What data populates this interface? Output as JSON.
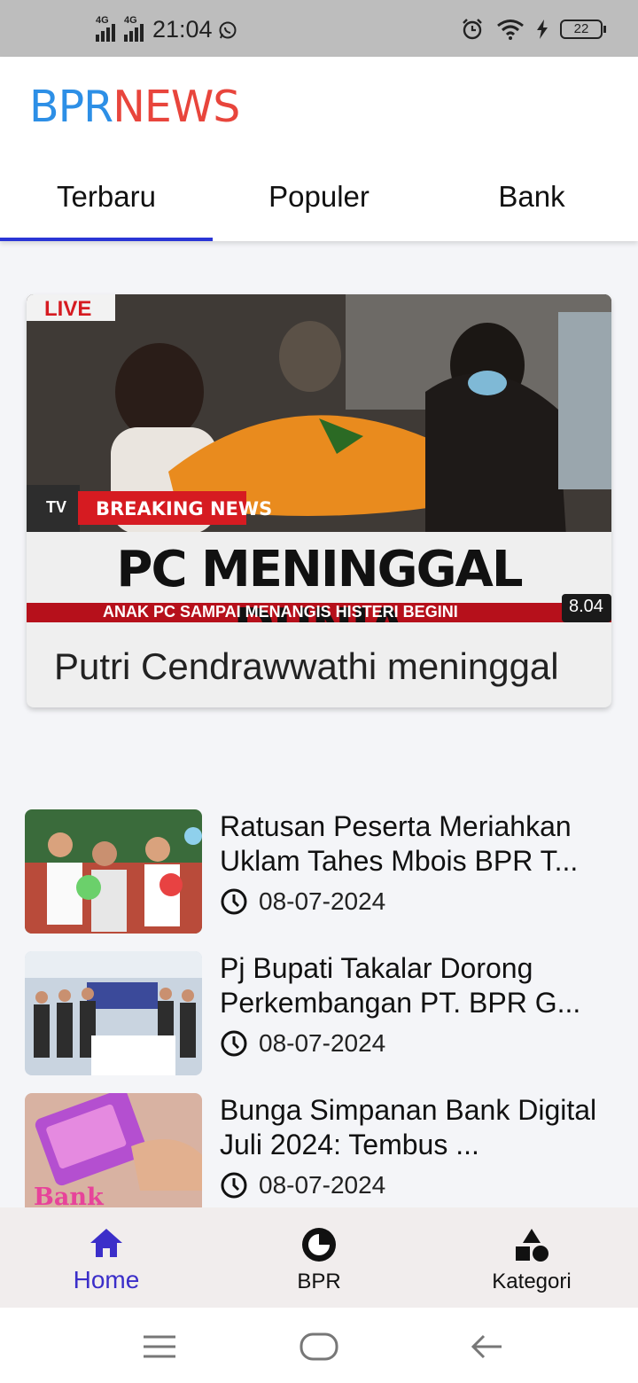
{
  "status": {
    "time": "21:04",
    "net1": "4G",
    "net2": "4G",
    "battery": "22"
  },
  "app": {
    "logo_part1": "BPR",
    "logo_part2": "NEWS"
  },
  "tabs": [
    {
      "label": "Terbaru"
    },
    {
      "label": "Populer"
    },
    {
      "label": "Bank"
    }
  ],
  "hero": {
    "live_label": "LIVE",
    "breaking_label": "BREAKING NEWS",
    "tv_label": "TV",
    "headline": "PC MENINGGAL DUNIA",
    "subline": "ANAK PC SAMPAI MENANGIS HISTERI BEGINI",
    "time_label": "8.04",
    "title": "Putri Cendrawwathi meninggal"
  },
  "news": [
    {
      "title": "Ratusan Peserta Meriahkan Uklam Tahes Mbois BPR T...",
      "date": "08-07-2024"
    },
    {
      "title": "Pj Bupati Takalar Dorong Perkembangan PT. BPR G...",
      "date": "08-07-2024"
    },
    {
      "title": "Bunga Simpanan Bank Digital Juli 2024: Tembus ...",
      "date": "08-07-2024",
      "thumb_caption": "Bank Digital"
    }
  ],
  "bottom_nav": [
    {
      "label": "Home"
    },
    {
      "label": "BPR"
    },
    {
      "label": "Kategori"
    }
  ],
  "colors": {
    "accent": "#3b2ec9",
    "logo_blue": "#2d8fe6",
    "logo_red": "#e8453c",
    "tab_indicator": "#2a35d6"
  }
}
